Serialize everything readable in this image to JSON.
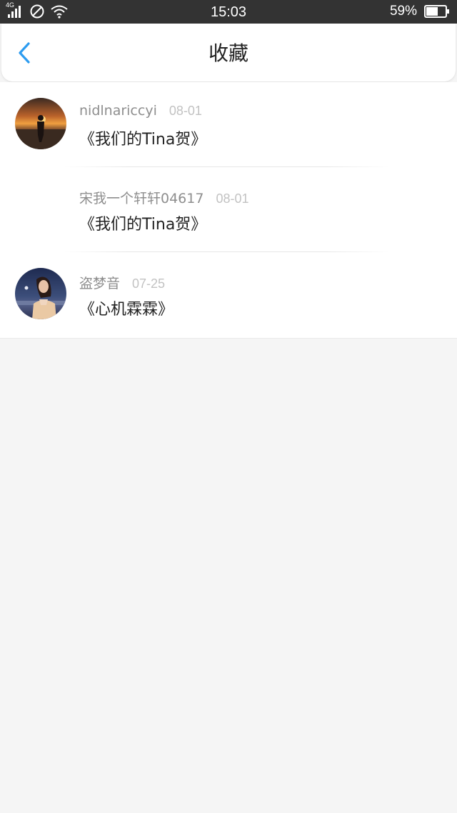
{
  "status_bar": {
    "network": "4G",
    "time": "15:03",
    "battery": "59%",
    "icons": [
      "signal-icon",
      "do-not-disturb-icon",
      "wifi-icon",
      "battery-icon"
    ]
  },
  "header": {
    "title": "收藏",
    "back_icon": "chevron-left-icon",
    "accent": "#2d9cf0"
  },
  "favorites": [
    {
      "username": "nidlnariccyi",
      "date": "08-01",
      "title": "《我们的Tina贺》",
      "avatar": "sunset-silhouette-avatar"
    },
    {
      "username": "宋我一个轩轩04617",
      "date": "08-01",
      "title": "《我们的Tina贺》",
      "avatar": ""
    },
    {
      "username": "盗梦音",
      "date": "07-25",
      "title": "《心机霖霖》",
      "avatar": "woman-portrait-avatar"
    }
  ]
}
